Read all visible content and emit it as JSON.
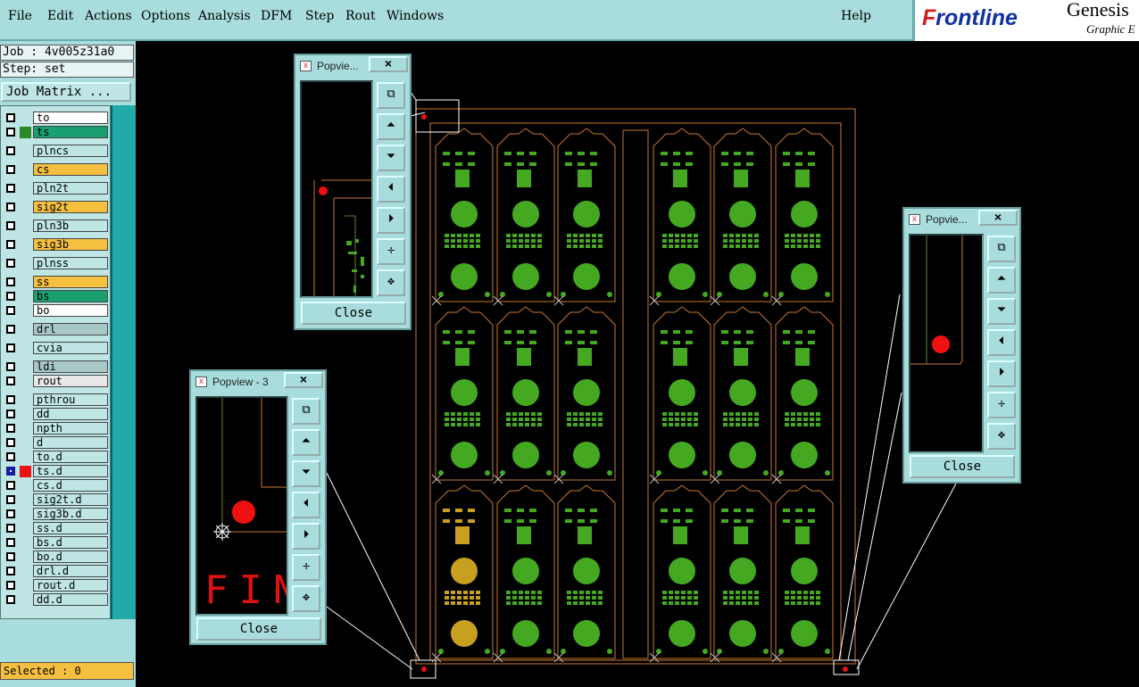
{
  "menu": {
    "items": [
      "File",
      "Edit",
      "Actions",
      "Options",
      "Analysis",
      "DFM",
      "Step",
      "Rout",
      "Windows"
    ],
    "help": "Help"
  },
  "brand": {
    "logo_prefix": "F",
    "logo_rest": "rontline",
    "product": "Genesis",
    "subtitle": "Graphic E"
  },
  "left": {
    "job_label": "Job : 4v005z31a0",
    "step_label": "Step: set",
    "job_matrix": "Job Matrix ...",
    "selected": "Selected : 0",
    "layers": [
      {
        "name": "to",
        "color": "#ffffff"
      },
      {
        "name": "ts",
        "color": "#1aa070",
        "swatch": "#2a8a2a"
      },
      {
        "name": "plncs",
        "color": "#bfe5e5"
      },
      {
        "name": "cs",
        "color": "#f5c040"
      },
      {
        "name": "pln2t",
        "color": "#bfe5e5"
      },
      {
        "name": "sig2t",
        "color": "#f5c040"
      },
      {
        "name": "pln3b",
        "color": "#bfe5e5"
      },
      {
        "name": "sig3b",
        "color": "#f5c040"
      },
      {
        "name": "plnss",
        "color": "#bfe5e5"
      },
      {
        "name": "ss",
        "color": "#f5c040"
      },
      {
        "name": "bs",
        "color": "#1aa070"
      },
      {
        "name": "bo",
        "color": "#ffffff"
      },
      {
        "name": "drl",
        "color": "#a8c8c8"
      },
      {
        "name": "cvia",
        "color": "#bfe5e5"
      },
      {
        "name": "ldi",
        "color": "#a8c8c8"
      },
      {
        "name": "rout",
        "color": "#e8e8e8"
      },
      {
        "name": "pthrou",
        "color": "#bfe5e5"
      },
      {
        "name": "dd",
        "color": "#bfe5e5"
      },
      {
        "name": "npth",
        "color": "#bfe5e5"
      },
      {
        "name": "d",
        "color": "#bfe5e5"
      },
      {
        "name": "to.d",
        "color": "#bfe5e5"
      },
      {
        "name": "ts.d",
        "color": "#bfe5e5",
        "swatch": "#ee1111",
        "active": true
      },
      {
        "name": "cs.d",
        "color": "#bfe5e5"
      },
      {
        "name": "sig2t.d",
        "color": "#bfe5e5"
      },
      {
        "name": "sig3b.d",
        "color": "#bfe5e5"
      },
      {
        "name": "ss.d",
        "color": "#bfe5e5"
      },
      {
        "name": "bs.d",
        "color": "#bfe5e5"
      },
      {
        "name": "bo.d",
        "color": "#bfe5e5"
      },
      {
        "name": "drl.d",
        "color": "#bfe5e5"
      },
      {
        "name": "rout.d",
        "color": "#bfe5e5"
      },
      {
        "name": "dd.d",
        "color": "#bfe5e5"
      }
    ]
  },
  "popviews": [
    {
      "title": "Popvie...",
      "close": "Close",
      "close_x": "×"
    },
    {
      "title": "Popview - 3",
      "close": "Close",
      "close_x": "×"
    },
    {
      "title": "Popvie...",
      "close": "Close",
      "close_x": "×"
    }
  ],
  "canvas": {
    "fin_text": "FIN"
  },
  "colors": {
    "board_green": "#44a820",
    "pad_gold": "#c8a020",
    "outline": "#c87830",
    "via_red": "#ee1111"
  }
}
